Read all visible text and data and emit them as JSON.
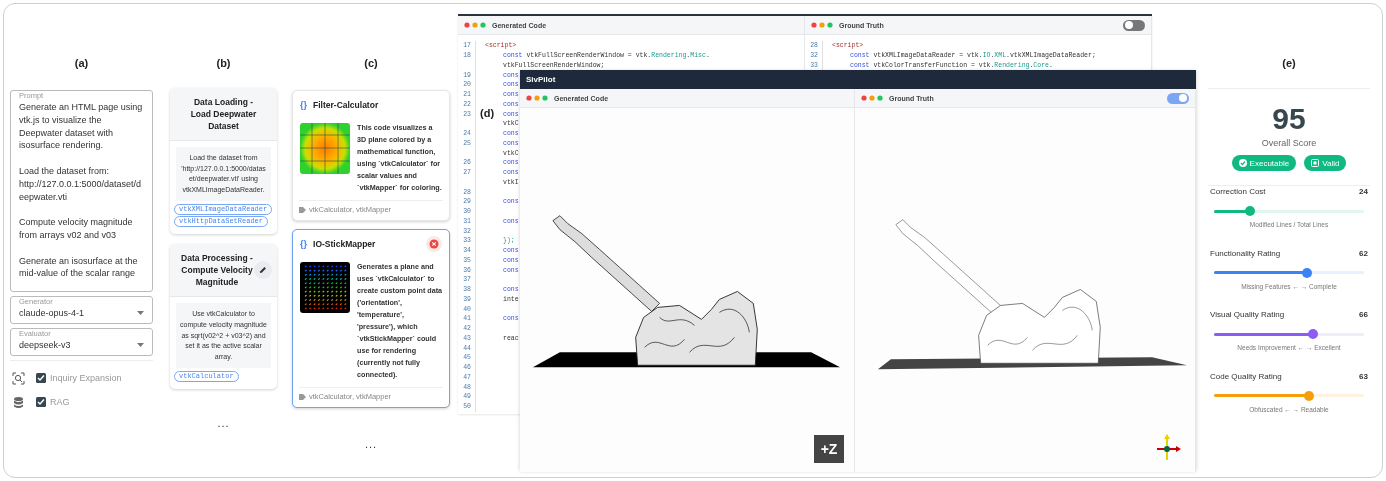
{
  "prompt_panel": {
    "label": "(a)",
    "prompt": {
      "label": "Prompt",
      "paragraphs": [
        "Generate an HTML page using vtk.js to visualize the Deepwater dataset with isosurface rendering.",
        "Load the dataset from: http://127.0.0.1:5000/dataset/deepwater.vti",
        "Compute velocity magnitude from arrays v02 and v03",
        "Generate an isosurface at the mid-value of the scalar range"
      ]
    },
    "selects": [
      {
        "label": "Generator",
        "value": "claude-opus-4-1"
      },
      {
        "label": "Evaluator",
        "value": "deepseek-v3"
      }
    ],
    "options": [
      {
        "label": "Inquiry Expansion",
        "checked": true
      },
      {
        "label": "RAG",
        "checked": true
      }
    ]
  },
  "plan_panel": {
    "label": "(b)",
    "steps": [
      {
        "title": "Data Loading - Load Deepwater Dataset",
        "description": "Load the dataset from 'http://127.0.0.1:5000/dataset/deepwater.vti' using vtkXMLImageDataReader.",
        "tags": [
          "vtkXMLImageDataReader",
          "vtkHttpDataSetReader"
        ],
        "editable": false
      },
      {
        "title": "Data Processing - Compute Velocity Magnitude",
        "description": "Use vtkCalculator to compute velocity magnitude as sqrt(v02^2 + v03^2) and set it as the active scalar array.",
        "tags": [
          "vtkCalculator"
        ],
        "editable": true
      }
    ],
    "more": "..."
  },
  "examples_panel": {
    "label": "(c)",
    "examples": [
      {
        "icon": "{}",
        "title": "Filter-Calculator",
        "kind": "heatmap",
        "description": "This code visualizes a 3D plane colored by a mathematical function, using `vtkCalculator` for scalar values and `vtkMapper` for coloring.",
        "tags": "vtkCalculator, vtkMapper",
        "selected": false
      },
      {
        "icon": "{}",
        "title": "IO-StickMapper",
        "kind": "glyphs",
        "description": "Generates a plane and uses `vtkCalculator` to create custom point data ('orientation', 'temperature', 'pressure'), which `vtkStickMapper` could use for rendering (currently not fully connected).",
        "tags": "vtkCalculator, vtkMapper",
        "selected": true
      }
    ],
    "more": "..."
  },
  "code_view": {
    "label": "(d)",
    "back_window": {
      "panes": [
        {
          "title": "Generated Code",
          "lines": [
            {
              "number": "17",
              "tokens": [
                {
                  "kind": "tag",
                  "text": "<script>"
                }
              ],
              "children": [
                {
                  "number": "18",
                  "tokens": [
                    {
                      "kind": "keyword",
                      "text": "const"
                    },
                    {
                      "kind": "plain",
                      "text": " vtkFullScreenRenderWindow = vtk."
                    },
                    {
                      "kind": "type",
                      "text": "Rendering"
                    },
                    {
                      "kind": "plain",
                      "text": "."
                    },
                    {
                      "kind": "type",
                      "text": "Misc"
                    },
                    {
                      "kind": "plain",
                      "text": "."
                    }
                  ]
                },
                {
                  "tokens": [
                    {
                      "kind": "plain",
                      "text": "vtkFullScreenRenderWindow;"
                    }
                  ]
                },
                {
                  "number": "19",
                  "tokens": [
                    {
                      "kind": "keyword",
                      "text": "cons"
                    }
                  ]
                },
                {
                  "number": "20",
                  "tokens": [
                    {
                      "kind": "keyword",
                      "text": "cons"
                    }
                  ]
                },
                {
                  "number": "21",
                  "tokens": [
                    {
                      "kind": "keyword",
                      "text": "cons"
                    }
                  ]
                },
                {
                  "number": "22",
                  "tokens": [
                    {
                      "kind": "keyword",
                      "text": "cons"
                    }
                  ]
                },
                {
                  "number": "23",
                  "tokens": [
                    {
                      "kind": "keyword",
                      "text": "cons"
                    }
                  ]
                },
                {
                  "tokens": [
                    {
                      "kind": "plain",
                      "text": "vtkC"
                    }
                  ]
                },
                {
                  "number": "24",
                  "tokens": [
                    {
                      "kind": "keyword",
                      "text": "cons"
                    }
                  ]
                },
                {
                  "number": "25",
                  "tokens": [
                    {
                      "kind": "keyword",
                      "text": "cons"
                    }
                  ]
                },
                {
                  "tokens": [
                    {
                      "kind": "plain",
                      "text": "vtkC"
                    }
                  ]
                },
                {
                  "number": "26",
                  "tokens": [
                    {
                      "kind": "keyword",
                      "text": "cons"
                    }
                  ]
                },
                {
                  "number": "27",
                  "tokens": [
                    {
                      "kind": "keyword",
                      "text": "cons"
                    }
                  ]
                },
                {
                  "tokens": [
                    {
                      "kind": "plain",
                      "text": "vtkI"
                    }
                  ]
                },
                {
                  "number": "28"
                },
                {
                  "number": "29",
                  "tokens": [
                    {
                      "kind": "keyword",
                      "text": "cons"
                    }
                  ]
                },
                {
                  "number": "30"
                },
                {
                  "number": "31",
                  "tokens": [
                    {
                      "kind": "keyword",
                      "text": "cons"
                    }
                  ]
                },
                {
                  "number": "32"
                },
                {
                  "number": "33",
                  "tokens": [
                    {
                      "kind": "type",
                      "text": "});"
                    }
                  ]
                },
                {
                  "number": "34",
                  "tokens": [
                    {
                      "kind": "keyword",
                      "text": "cons"
                    }
                  ]
                },
                {
                  "number": "35",
                  "tokens": [
                    {
                      "kind": "keyword",
                      "text": "cons"
                    }
                  ]
                },
                {
                  "number": "36",
                  "tokens": [
                    {
                      "kind": "keyword",
                      "text": "cons"
                    }
                  ]
                },
                {
                  "number": "37"
                },
                {
                  "number": "38",
                  "tokens": [
                    {
                      "kind": "keyword",
                      "text": "cons"
                    }
                  ]
                },
                {
                  "number": "39",
                  "tokens": [
                    {
                      "kind": "plain",
                      "text": "inte"
                    }
                  ]
                },
                {
                  "number": "40"
                },
                {
                  "number": "41",
                  "tokens": [
                    {
                      "kind": "keyword",
                      "text": "cons"
                    }
                  ]
                },
                {
                  "number": "42"
                },
                {
                  "number": "43",
                  "tokens": [
                    {
                      "kind": "plain",
                      "text": "reac"
                    }
                  ]
                },
                {
                  "number": "44"
                },
                {
                  "number": "45"
                },
                {
                  "number": "46"
                },
                {
                  "number": "47"
                },
                {
                  "number": "48"
                },
                {
                  "number": "49"
                },
                {
                  "number": "50"
                }
              ]
            }
          ]
        },
        {
          "title": "Ground Truth",
          "toggle_on": false,
          "lines": [
            {
              "number": "28",
              "tokens": [
                {
                  "kind": "tag",
                  "text": "<script>"
                }
              ],
              "children": [
                {
                  "number": "32",
                  "tokens": [
                    {
                      "kind": "keyword",
                      "text": "const"
                    },
                    {
                      "kind": "plain",
                      "text": " vtkXMLImageDataReader = vtk."
                    },
                    {
                      "kind": "type",
                      "text": "IO"
                    },
                    {
                      "kind": "plain",
                      "text": "."
                    },
                    {
                      "kind": "type",
                      "text": "XML"
                    },
                    {
                      "kind": "plain",
                      "text": ".vtkXMLImageDataReader;"
                    }
                  ]
                },
                {
                  "number": "33",
                  "tokens": [
                    {
                      "kind": "keyword",
                      "text": "const"
                    },
                    {
                      "kind": "plain",
                      "text": " vtkColorTransferFunction = vtk."
                    },
                    {
                      "kind": "type",
                      "text": "Rendering"
                    },
                    {
                      "kind": "plain",
                      "text": "."
                    },
                    {
                      "kind": "type",
                      "text": "Core"
                    },
                    {
                      "kind": "plain",
                      "text": "."
                    }
                  ]
                }
              ]
            }
          ]
        }
      ]
    },
    "front_window": {
      "title": "SivPilot",
      "panes": [
        {
          "title": "Generated Code",
          "kind": "shaded",
          "marker": {
            "kind": "label",
            "text": "+Z"
          }
        },
        {
          "title": "Ground Truth",
          "toggle_on": true,
          "kind": "outline",
          "marker": {
            "kind": "axes"
          }
        }
      ]
    }
  },
  "score_panel": {
    "label": "(e)",
    "score": "95",
    "score_label": "Overall Score",
    "badges": [
      "Executable",
      "Valid"
    ],
    "ratings": [
      {
        "name": "Correction Cost",
        "value": "24",
        "level": 0.24,
        "color": "#10b981",
        "caption": "Modified Lines / Total Lines"
      },
      {
        "name": "Functionality Rating",
        "value": "62",
        "level": 0.62,
        "color": "#3b82f6",
        "caption": "Missing Features ← → Complete"
      },
      {
        "name": "Visual Quality Rating",
        "value": "66",
        "level": 0.66,
        "color": "#8b5cf6",
        "caption": "Needs Improvement ← → Excellent"
      },
      {
        "name": "Code Quality Rating",
        "value": "63",
        "level": 0.63,
        "color": "#f59e0b",
        "caption": "Obfuscated ← → Readable"
      }
    ]
  }
}
